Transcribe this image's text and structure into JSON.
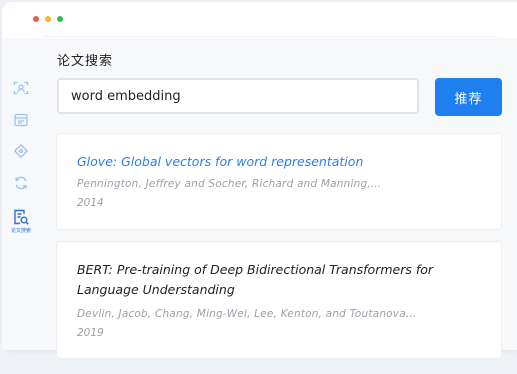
{
  "window": {
    "controls": [
      "close",
      "minimize",
      "maximize"
    ]
  },
  "sidebar": {
    "items": [
      {
        "icon": "scan-icon"
      },
      {
        "icon": "document-icon"
      },
      {
        "icon": "tag-icon"
      },
      {
        "icon": "refresh-icon"
      },
      {
        "icon": "paper-search-icon",
        "label": "论文搜索",
        "active": true
      }
    ]
  },
  "main": {
    "title": "论文搜索",
    "search": {
      "value": "word embedding",
      "button_label": "推荐"
    },
    "results": [
      {
        "title": "Glove: Global vectors for word representation",
        "authors": "Pennington, Jeffrey and Socher, Richard and Manning,...",
        "year": "2014"
      },
      {
        "title": "BERT: Pre-training of Deep Bidirectional Transformers for Language Understanding",
        "authors": "Devlin, Jacob, Chang, Ming-Wei, Lee, Kenton, and Toutanova...",
        "year": "2019"
      }
    ]
  },
  "colors": {
    "accent": "#1f7ef0",
    "link_title": "#2f7de1",
    "muted_text": "#9aa0a8",
    "sidebar_icon": "#9cc3ee"
  }
}
